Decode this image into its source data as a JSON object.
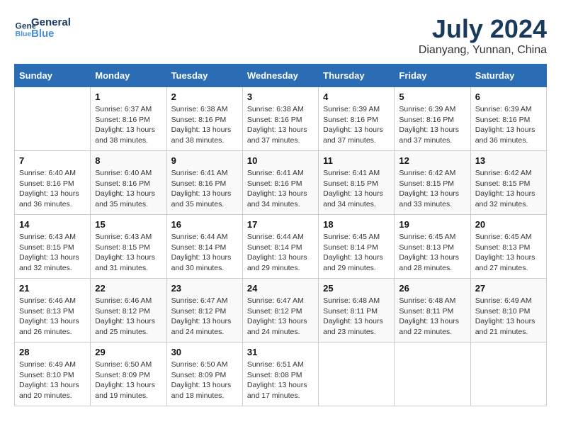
{
  "header": {
    "logo_line1": "General",
    "logo_line2": "Blue",
    "title": "July 2024",
    "subtitle": "Dianyang, Yunnan, China"
  },
  "weekdays": [
    "Sunday",
    "Monday",
    "Tuesday",
    "Wednesday",
    "Thursday",
    "Friday",
    "Saturday"
  ],
  "weeks": [
    [
      {
        "day": "",
        "sunrise": "",
        "sunset": "",
        "daylight": ""
      },
      {
        "day": "1",
        "sunrise": "Sunrise: 6:37 AM",
        "sunset": "Sunset: 8:16 PM",
        "daylight": "Daylight: 13 hours and 38 minutes."
      },
      {
        "day": "2",
        "sunrise": "Sunrise: 6:38 AM",
        "sunset": "Sunset: 8:16 PM",
        "daylight": "Daylight: 13 hours and 38 minutes."
      },
      {
        "day": "3",
        "sunrise": "Sunrise: 6:38 AM",
        "sunset": "Sunset: 8:16 PM",
        "daylight": "Daylight: 13 hours and 37 minutes."
      },
      {
        "day": "4",
        "sunrise": "Sunrise: 6:39 AM",
        "sunset": "Sunset: 8:16 PM",
        "daylight": "Daylight: 13 hours and 37 minutes."
      },
      {
        "day": "5",
        "sunrise": "Sunrise: 6:39 AM",
        "sunset": "Sunset: 8:16 PM",
        "daylight": "Daylight: 13 hours and 37 minutes."
      },
      {
        "day": "6",
        "sunrise": "Sunrise: 6:39 AM",
        "sunset": "Sunset: 8:16 PM",
        "daylight": "Daylight: 13 hours and 36 minutes."
      }
    ],
    [
      {
        "day": "7",
        "sunrise": "Sunrise: 6:40 AM",
        "sunset": "Sunset: 8:16 PM",
        "daylight": "Daylight: 13 hours and 36 minutes."
      },
      {
        "day": "8",
        "sunrise": "Sunrise: 6:40 AM",
        "sunset": "Sunset: 8:16 PM",
        "daylight": "Daylight: 13 hours and 35 minutes."
      },
      {
        "day": "9",
        "sunrise": "Sunrise: 6:41 AM",
        "sunset": "Sunset: 8:16 PM",
        "daylight": "Daylight: 13 hours and 35 minutes."
      },
      {
        "day": "10",
        "sunrise": "Sunrise: 6:41 AM",
        "sunset": "Sunset: 8:16 PM",
        "daylight": "Daylight: 13 hours and 34 minutes."
      },
      {
        "day": "11",
        "sunrise": "Sunrise: 6:41 AM",
        "sunset": "Sunset: 8:15 PM",
        "daylight": "Daylight: 13 hours and 34 minutes."
      },
      {
        "day": "12",
        "sunrise": "Sunrise: 6:42 AM",
        "sunset": "Sunset: 8:15 PM",
        "daylight": "Daylight: 13 hours and 33 minutes."
      },
      {
        "day": "13",
        "sunrise": "Sunrise: 6:42 AM",
        "sunset": "Sunset: 8:15 PM",
        "daylight": "Daylight: 13 hours and 32 minutes."
      }
    ],
    [
      {
        "day": "14",
        "sunrise": "Sunrise: 6:43 AM",
        "sunset": "Sunset: 8:15 PM",
        "daylight": "Daylight: 13 hours and 32 minutes."
      },
      {
        "day": "15",
        "sunrise": "Sunrise: 6:43 AM",
        "sunset": "Sunset: 8:15 PM",
        "daylight": "Daylight: 13 hours and 31 minutes."
      },
      {
        "day": "16",
        "sunrise": "Sunrise: 6:44 AM",
        "sunset": "Sunset: 8:14 PM",
        "daylight": "Daylight: 13 hours and 30 minutes."
      },
      {
        "day": "17",
        "sunrise": "Sunrise: 6:44 AM",
        "sunset": "Sunset: 8:14 PM",
        "daylight": "Daylight: 13 hours and 29 minutes."
      },
      {
        "day": "18",
        "sunrise": "Sunrise: 6:45 AM",
        "sunset": "Sunset: 8:14 PM",
        "daylight": "Daylight: 13 hours and 29 minutes."
      },
      {
        "day": "19",
        "sunrise": "Sunrise: 6:45 AM",
        "sunset": "Sunset: 8:13 PM",
        "daylight": "Daylight: 13 hours and 28 minutes."
      },
      {
        "day": "20",
        "sunrise": "Sunrise: 6:45 AM",
        "sunset": "Sunset: 8:13 PM",
        "daylight": "Daylight: 13 hours and 27 minutes."
      }
    ],
    [
      {
        "day": "21",
        "sunrise": "Sunrise: 6:46 AM",
        "sunset": "Sunset: 8:13 PM",
        "daylight": "Daylight: 13 hours and 26 minutes."
      },
      {
        "day": "22",
        "sunrise": "Sunrise: 6:46 AM",
        "sunset": "Sunset: 8:12 PM",
        "daylight": "Daylight: 13 hours and 25 minutes."
      },
      {
        "day": "23",
        "sunrise": "Sunrise: 6:47 AM",
        "sunset": "Sunset: 8:12 PM",
        "daylight": "Daylight: 13 hours and 24 minutes."
      },
      {
        "day": "24",
        "sunrise": "Sunrise: 6:47 AM",
        "sunset": "Sunset: 8:12 PM",
        "daylight": "Daylight: 13 hours and 24 minutes."
      },
      {
        "day": "25",
        "sunrise": "Sunrise: 6:48 AM",
        "sunset": "Sunset: 8:11 PM",
        "daylight": "Daylight: 13 hours and 23 minutes."
      },
      {
        "day": "26",
        "sunrise": "Sunrise: 6:48 AM",
        "sunset": "Sunset: 8:11 PM",
        "daylight": "Daylight: 13 hours and 22 minutes."
      },
      {
        "day": "27",
        "sunrise": "Sunrise: 6:49 AM",
        "sunset": "Sunset: 8:10 PM",
        "daylight": "Daylight: 13 hours and 21 minutes."
      }
    ],
    [
      {
        "day": "28",
        "sunrise": "Sunrise: 6:49 AM",
        "sunset": "Sunset: 8:10 PM",
        "daylight": "Daylight: 13 hours and 20 minutes."
      },
      {
        "day": "29",
        "sunrise": "Sunrise: 6:50 AM",
        "sunset": "Sunset: 8:09 PM",
        "daylight": "Daylight: 13 hours and 19 minutes."
      },
      {
        "day": "30",
        "sunrise": "Sunrise: 6:50 AM",
        "sunset": "Sunset: 8:09 PM",
        "daylight": "Daylight: 13 hours and 18 minutes."
      },
      {
        "day": "31",
        "sunrise": "Sunrise: 6:51 AM",
        "sunset": "Sunset: 8:08 PM",
        "daylight": "Daylight: 13 hours and 17 minutes."
      },
      {
        "day": "",
        "sunrise": "",
        "sunset": "",
        "daylight": ""
      },
      {
        "day": "",
        "sunrise": "",
        "sunset": "",
        "daylight": ""
      },
      {
        "day": "",
        "sunrise": "",
        "sunset": "",
        "daylight": ""
      }
    ]
  ]
}
